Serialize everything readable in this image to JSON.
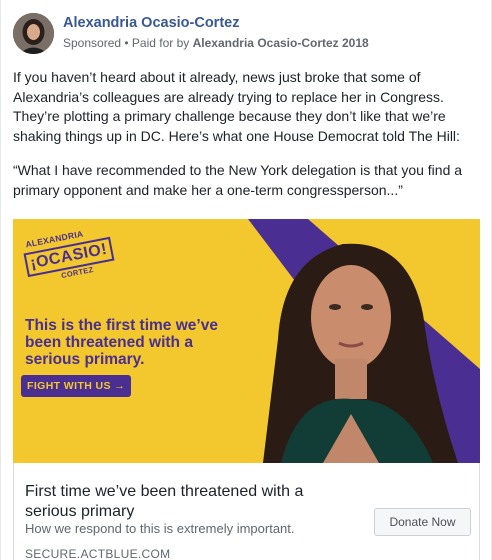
{
  "post": {
    "page_name": "Alexandria Ocasio-Cortez",
    "sponsored": "Sponsored",
    "separator": " • ",
    "paid_prefix": "Paid for by ",
    "paid_by": "Alexandria Ocasio-Cortez 2018",
    "paragraph1": "If you haven’t heard about it already, news just broke that some of Alexandria’s colleagues are already trying to replace her in Congress. They’re plotting a primary challenge because they don’t like that we’re shaking things up in DC. Here’s what one House Democrat told The Hill:",
    "paragraph2": "“What I have recommended to the New York delegation is that you find a primary opponent and make her a one-term congressperson...”"
  },
  "ad_image": {
    "logo_line1": "ALEXANDRIA",
    "logo_line2": "¡OCASIO!",
    "logo_line3": "CORTEZ",
    "headline": "This is the first time we’ve been threatened with a serious primary.",
    "cta": "FIGHT WITH US →",
    "colors": {
      "yellow": "#f2c82e",
      "purple": "#4b2e91"
    }
  },
  "link": {
    "title": "First time we’ve been threatened with a serious primary",
    "description": "How we respond to this is extremely important.",
    "domain": "SECURE.ACTBLUE.COM",
    "button": "Donate Now"
  }
}
